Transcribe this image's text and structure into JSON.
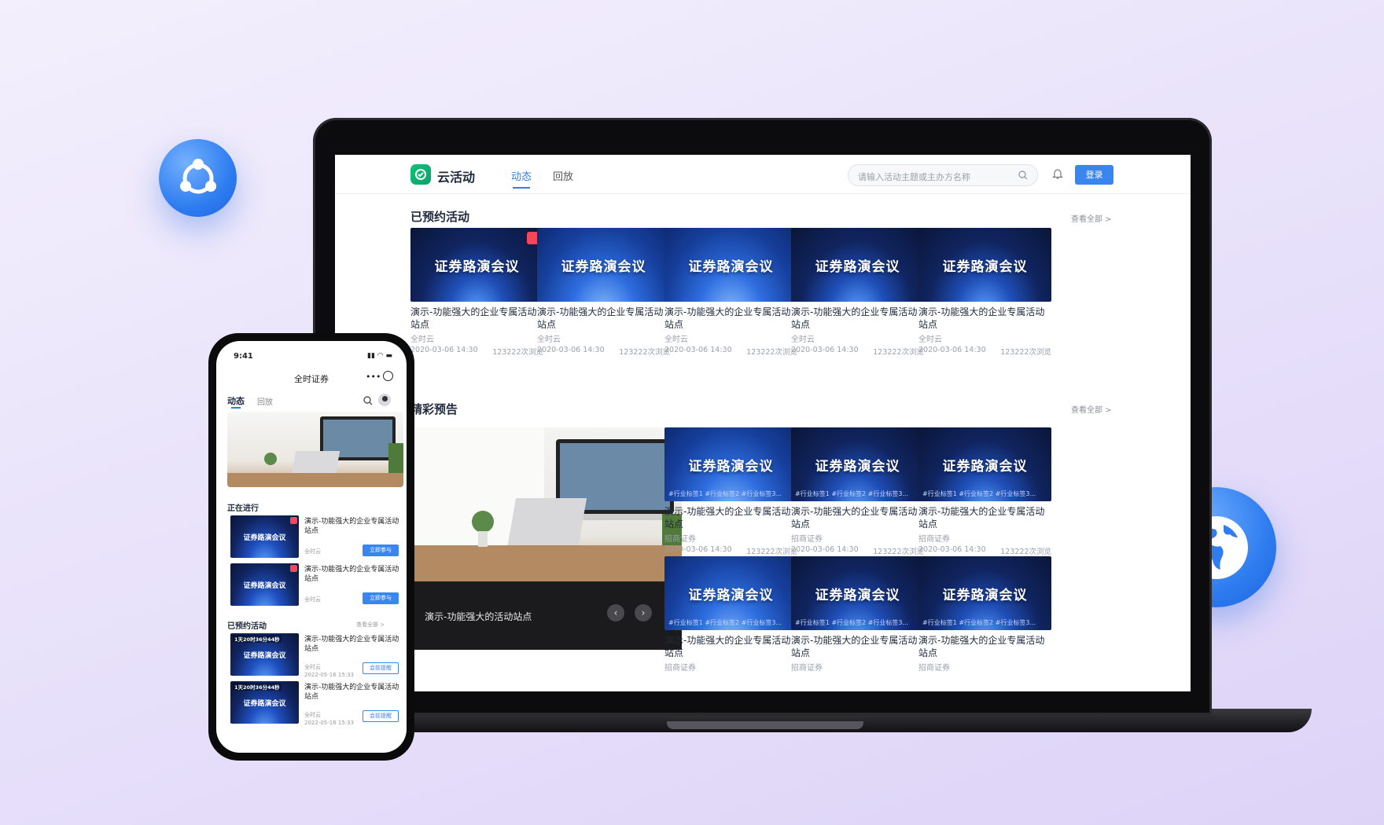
{
  "app": {
    "name": "云活动",
    "nav": [
      "动态",
      "回放"
    ],
    "search_placeholder": "请输入活动主题或主办方名称",
    "login": "登录"
  },
  "reserved": {
    "title": "已预约活动",
    "view_all": "查看全部 >",
    "cards": [
      {
        "thumb_title": "证券路演会议",
        "title": "演示-功能强大的企业专属活动站点",
        "org": "全时云",
        "date": "2020-03-06 14:30",
        "views": "123222次浏览",
        "badge": true
      },
      {
        "thumb_title": "证券路演会议",
        "title": "演示-功能强大的企业专属活动站点",
        "org": "全时云",
        "date": "2020-03-06 14:30",
        "views": "123222次浏览"
      },
      {
        "thumb_title": "证券路演会议",
        "title": "演示-功能强大的企业专属活动站点",
        "org": "全时云",
        "date": "2020-03-06 14:30",
        "views": "123222次浏览"
      },
      {
        "thumb_title": "证券路演会议",
        "title": "演示-功能强大的企业专属活动站点",
        "org": "全时云",
        "date": "2020-03-06 14:30",
        "views": "123222次浏览"
      },
      {
        "thumb_title": "证券路演会议",
        "title": "演示-功能强大的企业专属活动站点",
        "org": "全时云",
        "date": "2020-03-06 14:30",
        "views": "123222次浏览"
      }
    ]
  },
  "preview": {
    "title": "精彩预告",
    "view_all": "查看全部 >",
    "featured_caption": "演示-功能强大的活动站点",
    "tags": "#行业标签1 #行业标签2 #行业标签3...",
    "cards": [
      {
        "thumb_title": "证券路演会议",
        "title": "演示-功能强大的企业专属活动站点",
        "org": "招商证券",
        "date": "2020-03-06 14:30",
        "views": "123222次浏览"
      },
      {
        "thumb_title": "证券路演会议",
        "title": "演示-功能强大的企业专属活动站点",
        "org": "招商证券",
        "date": "2020-03-06 14:30",
        "views": "123222次浏览"
      },
      {
        "thumb_title": "证券路演会议",
        "title": "演示-功能强大的企业专属活动站点",
        "org": "招商证券",
        "date": "2020-03-06 14:30",
        "views": "123222次浏览"
      },
      {
        "thumb_title": "证券路演会议",
        "title": "演示-功能强大的企业专属活动站点",
        "org": "招商证券"
      },
      {
        "thumb_title": "证券路演会议",
        "title": "演示-功能强大的企业专属活动站点",
        "org": "招商证券"
      },
      {
        "thumb_title": "证券路演会议",
        "title": "演示-功能强大的企业专属活动站点",
        "org": "招商证券"
      }
    ]
  },
  "phone": {
    "time": "9:41",
    "title": "全时证券",
    "tabs": [
      "动态",
      "回放"
    ],
    "ongoing": {
      "title": "正在进行",
      "items": [
        {
          "thumb_title": "证券路演会议",
          "title": "演示-功能强大的企业专属活动站点",
          "org": "全时云",
          "button": "立即参与"
        },
        {
          "thumb_title": "证券路演会议",
          "title": "演示-功能强大的企业专属活动站点",
          "org": "全时云",
          "button": "立即参与"
        }
      ]
    },
    "reserved": {
      "title": "已预约活动",
      "view_all": "查看全部 >",
      "items": [
        {
          "thumb_title": "证券路演会议",
          "countdown": "1天20时36分44秒",
          "title": "演示-功能强大的企业专属活动站点",
          "org": "全时云",
          "date": "2022-05-16 15:33",
          "button": "会前提醒"
        },
        {
          "thumb_title": "证券路演会议",
          "countdown": "1天20时36分44秒",
          "title": "演示-功能强大的企业专属活动站点",
          "org": "全时云",
          "date": "2022-05-16 15:33",
          "button": "会前提醒"
        }
      ]
    }
  },
  "colors": {
    "accent": "#3a86f0",
    "badge": "#f2485a",
    "logo": "#12c27a"
  }
}
